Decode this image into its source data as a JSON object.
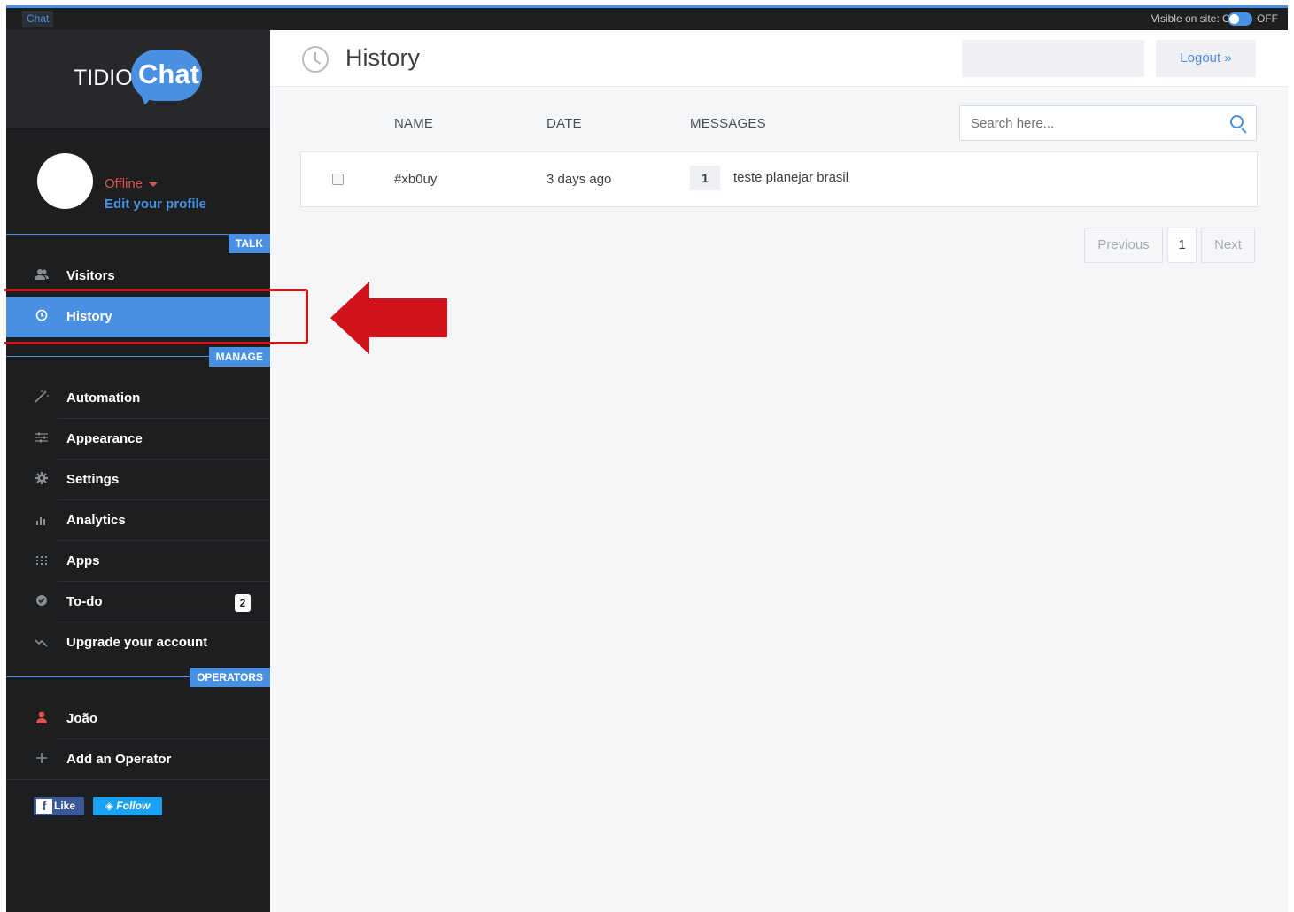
{
  "topbar": {
    "tab_label": "Chat",
    "visible_label": "Visible on site: ON",
    "off_label": "OFF"
  },
  "logo": {
    "brand": "TIDIO",
    "product": "Chat"
  },
  "profile": {
    "status": "Offline",
    "edit_link": "Edit your profile"
  },
  "sections": {
    "talk": "TALK",
    "manage": "MANAGE",
    "operators": "OPERATORS"
  },
  "nav": {
    "talk": [
      {
        "label": "Visitors",
        "icon": "users-icon"
      },
      {
        "label": "History",
        "icon": "clock-icon",
        "active": true
      }
    ],
    "manage": [
      {
        "label": "Automation",
        "icon": "magic-wand-icon"
      },
      {
        "label": "Appearance",
        "icon": "sliders-icon"
      },
      {
        "label": "Settings",
        "icon": "gear-icon"
      },
      {
        "label": "Analytics",
        "icon": "bar-chart-icon"
      },
      {
        "label": "Apps",
        "icon": "grid-icon"
      },
      {
        "label": "To-do",
        "icon": "check-circle-icon",
        "badge": "2"
      },
      {
        "label": "Upgrade your account",
        "icon": "trend-icon"
      }
    ],
    "operators": [
      {
        "label": "João",
        "icon": "user-icon"
      },
      {
        "label": "Add an Operator",
        "icon": "plus-icon"
      }
    ]
  },
  "social": {
    "like": "Like",
    "follow": "Follow"
  },
  "header": {
    "title": "History",
    "logout": "Logout »"
  },
  "table": {
    "columns": [
      "NAME",
      "DATE",
      "MESSAGES"
    ],
    "search_placeholder": "Search here...",
    "rows": [
      {
        "name": "#xb0uy",
        "date": "3 days ago",
        "count": "1",
        "message": "teste planejar brasil"
      }
    ]
  },
  "pagination": {
    "previous": "Previous",
    "current": "1",
    "next": "Next"
  },
  "colors": {
    "accent": "#4a90e2",
    "sidebar": "#1d1e20",
    "annotation": "#d0131a",
    "offline": "#d9534f"
  }
}
